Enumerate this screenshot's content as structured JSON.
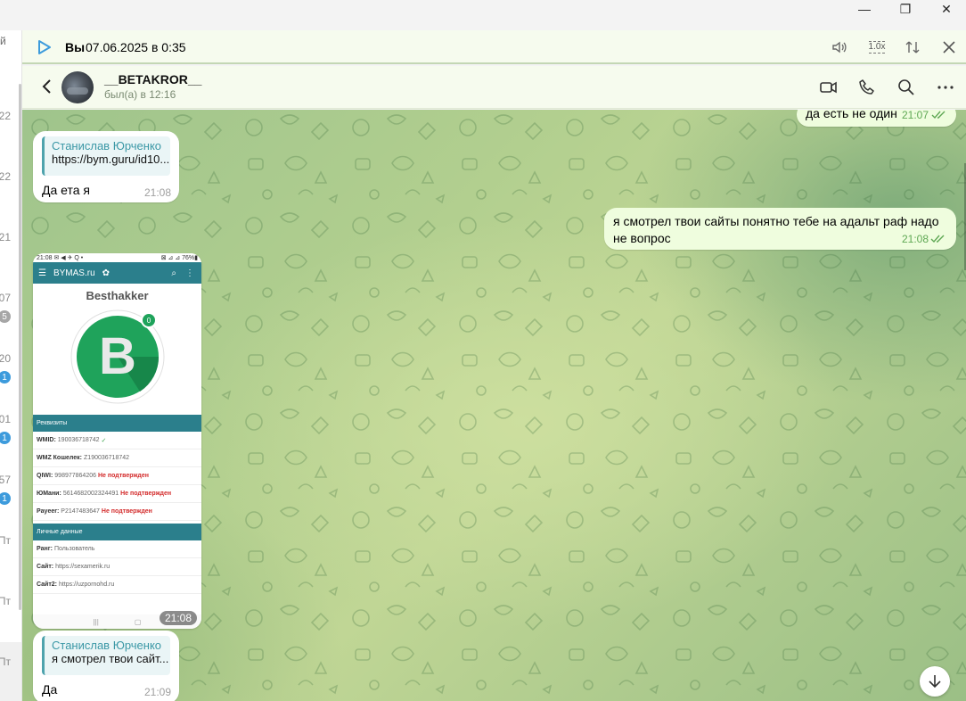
{
  "window": {
    "minimize": "—",
    "maximize": "❐",
    "close": "✕"
  },
  "left_strip": {
    "edge_char": "й",
    "items": [
      {
        "label": "22"
      },
      {
        "label": "22"
      },
      {
        "label": "21"
      },
      {
        "label": "07",
        "badge": "5"
      },
      {
        "label": "20",
        "badge": "1"
      },
      {
        "label": "01",
        "badge": "1"
      },
      {
        "label": "57",
        "badge": "1"
      },
      {
        "label": "Пт"
      },
      {
        "label": "Пт"
      },
      {
        "label": "Пт"
      }
    ]
  },
  "player": {
    "author": "Вы",
    "date": "07.06.2025 в 0:35",
    "speed": "1.0x"
  },
  "header": {
    "name": "__BETAKROR__",
    "status": "был(а) в 12:16"
  },
  "messages": {
    "m1": {
      "text": "да есть не один",
      "time": "21:07"
    },
    "m2": {
      "reply_name": "Станислав Юрченко",
      "reply_text": "https://bym.guru/id10...",
      "text": "Да ета я",
      "time": "21:08"
    },
    "m3": {
      "text": "я смотрел твои сайты понятно тебе на адальт раф надо не вопрос",
      "time": "21:08"
    },
    "m4": {
      "time": "21:08"
    },
    "m5": {
      "reply_name": "Станислав Юрченко",
      "reply_text": "я смотрел твои сайт...",
      "text": "Да",
      "time": "21:09"
    }
  },
  "phone_screenshot": {
    "status_left": "21:08 ✉ ◀ ✈ Q •",
    "status_right": "⊠ ⊿ ⊿ 76%▮",
    "app_name": "BYMAS.ru",
    "title": "Besthakker",
    "badge": "0",
    "logo_letter": "B",
    "section1": "Реквизиты",
    "rows1": [
      {
        "k": "WMID:",
        "v": "190036718742",
        "extra": "✓",
        "extra_type": "green"
      },
      {
        "k": "WMZ Кошелек:",
        "v": "Z190036718742",
        "extra": "",
        "extra_type": ""
      },
      {
        "k": "QIWI:",
        "v": "998977864206",
        "extra": "Не подтвержден",
        "extra_type": "red"
      },
      {
        "k": "ЮMани:",
        "v": "5614682002324491",
        "extra": "Не подтвержден",
        "extra_type": "red"
      },
      {
        "k": "Payeer:",
        "v": "P2147483647",
        "extra": "Не подтвержден",
        "extra_type": "red"
      }
    ],
    "section2": "Личные данные",
    "rows2": [
      {
        "k": "Ранг:",
        "v": "Пользователь"
      },
      {
        "k": "Сайт:",
        "v": "https://sexamerik.ru"
      },
      {
        "k": "Сайт2:",
        "v": "https://uzpornohd.ru"
      }
    ]
  },
  "colors": {
    "accent": "#3d9bdc",
    "outgoing_bubble": "#effdde",
    "header_bg": "#f6fbee",
    "teal": "#2b7f8c"
  }
}
